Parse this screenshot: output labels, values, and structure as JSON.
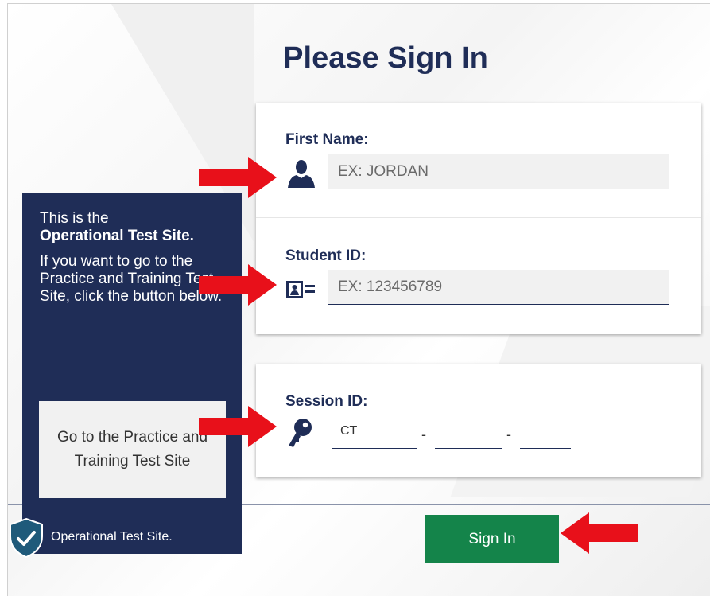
{
  "title": "Please Sign In",
  "first_name": {
    "label": "First Name:",
    "placeholder": "EX: JORDAN",
    "icon": "person-icon"
  },
  "student_id": {
    "label": "Student ID:",
    "placeholder": "EX: 123456789",
    "icon": "id-card-icon"
  },
  "session_id": {
    "label": "Session ID:",
    "part1": "CT",
    "part2": "",
    "part3": "",
    "separator": "-",
    "icon": "key-icon"
  },
  "sidebar": {
    "line1": "This is the",
    "line2": "Operational Test Site.",
    "line3": "If you want to go to the Practice and Training Test Site, click the button below.",
    "button_label": "Go to the Practice and Training Test Site",
    "site_label": "Operational Test Site.",
    "icon": "shield-check-icon"
  },
  "sign_in_label": "Sign In",
  "colors": {
    "navy": "#1f2d57",
    "green": "#14844a",
    "arrow": "#e8101a"
  }
}
